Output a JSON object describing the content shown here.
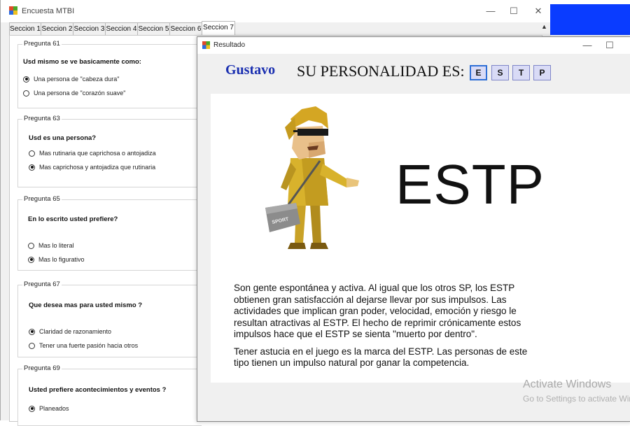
{
  "main_window": {
    "title": "Encuesta MTBI",
    "controls": {
      "minimize": "—",
      "maximize": "☐",
      "close": "✕"
    },
    "tabs": [
      {
        "label": "Seccion 1"
      },
      {
        "label": "Seccion 2"
      },
      {
        "label": "Seccion 3"
      },
      {
        "label": "Seccion 4"
      },
      {
        "label": "Seccion 5"
      },
      {
        "label": "Seccion 6"
      },
      {
        "label": "Seccion 7",
        "active": true
      }
    ],
    "scroll_up": "▲",
    "questions": [
      {
        "legend": "Pregunta 61",
        "text": "Usd mismo se ve basicamente como:",
        "options": [
          {
            "label": "Una persona de \"cabeza dura\"",
            "checked": true
          },
          {
            "label": "Una persona de \"corazón suave\"",
            "checked": false
          }
        ]
      },
      {
        "legend": "Pregunta 63",
        "text": "Usd es una persona?",
        "options": [
          {
            "label": "Mas rutinaria que caprichosa o antojadiza",
            "checked": false
          },
          {
            "label": "Mas caprichosa y antojadiza que rutinaria",
            "checked": true
          }
        ]
      },
      {
        "legend": "Pregunta 65",
        "text": "En lo escrito usted prefiere?",
        "options": [
          {
            "label": "Mas lo literal",
            "checked": false
          },
          {
            "label": "Mas lo figurativo",
            "checked": true
          }
        ]
      },
      {
        "legend": "Pregunta 67",
        "text": "Que desea mas para usted mismo ?",
        "options": [
          {
            "label": "Claridad de razonamiento",
            "checked": true
          },
          {
            "label": "Tener una fuerte pasión hacia otros",
            "checked": false
          }
        ]
      },
      {
        "legend": "Pregunta 69",
        "text": "Usted prefiere acontecimientos y eventos ?",
        "options": [
          {
            "label": "Planeados",
            "checked": true
          }
        ]
      }
    ]
  },
  "result_dialog": {
    "title": "Resultado",
    "controls": {
      "minimize": "—",
      "maximize": "☐"
    },
    "user_name": "Gustavo",
    "personality_label": "SU PERSONALIDAD ES:",
    "letters": [
      {
        "value": "E",
        "selected": true
      },
      {
        "value": "S",
        "selected": false
      },
      {
        "value": "T",
        "selected": false
      },
      {
        "value": "P",
        "selected": false
      }
    ],
    "type_big": "ESTP",
    "character_bag_text": "SPORT",
    "description": [
      "Son gente espontánea y activa. Al igual que los otros SP, los ESTP obtienen gran satisfacción al dejarse llevar por sus impulsos. Las actividades que implican gran poder, velocidad, emoción y riesgo le resultan atractivas al ESTP. El hecho de reprimir crónicamente estos impulsos hace que el ESTP se sienta \"muerto por dentro\".",
      "Tener astucia en el juego es la marca del ESTP. Las personas de este tipo tienen un impulso natural por ganar la competencia."
    ]
  },
  "watermark": {
    "line1": "Activate Windows",
    "line2": "Go to Settings to activate Windows."
  },
  "colors": {
    "accent_blue": "#1a2fb0",
    "taskbar_blue": "#0a3cff",
    "letter_bg": "#d9dbf6"
  }
}
